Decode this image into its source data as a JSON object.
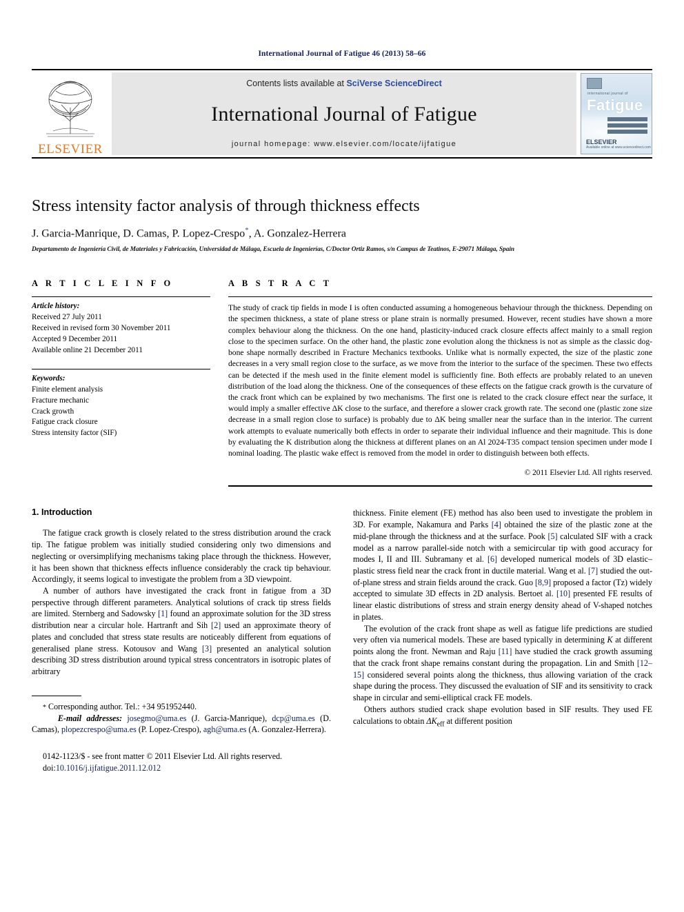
{
  "running_head": "International Journal of Fatigue 46 (2013) 58–66",
  "masthead": {
    "publisher_name": "ELSEVIER",
    "contents_prefix": "Contents lists available at ",
    "contents_link": "SciVerse ScienceDirect",
    "journal_title": "International Journal of Fatigue",
    "homepage": "journal homepage: www.elsevier.com/locate/ijfatigue",
    "cover": {
      "small_title": "international journal of",
      "big_title": "Fatigue",
      "foot_brand": "ELSEVIER",
      "foot_tagline": "Available online at www.sciencedirect.com"
    }
  },
  "article": {
    "title": "Stress intensity factor analysis of through thickness effects",
    "authors": "J. Garcia-Manrique, D. Camas, P. Lopez-Crespo",
    "authors_corresponding_mark": "*",
    "authors_tail": ", A. Gonzalez-Herrera",
    "affiliation": "Departamento de Ingeniería Civil, de Materiales y Fabricación, Universidad de Málaga, Escuela de Ingenierías, C/Doctor Ortiz Ramos, s/n Campus de Teatinos, E-29071 Málaga, Spain"
  },
  "article_info": {
    "heading": "A R T I C L E   I N F O",
    "history_label": "Article history:",
    "history": [
      "Received 27 July 2011",
      "Received in revised form 30 November 2011",
      "Accepted 9 December 2011",
      "Available online 21 December 2011"
    ],
    "keywords_label": "Keywords:",
    "keywords": [
      "Finite element analysis",
      "Fracture mechanic",
      "Crack growth",
      "Fatigue crack closure",
      "Stress intensity factor (SIF)"
    ]
  },
  "abstract": {
    "heading": "A B S T R A C T",
    "text": "The study of crack tip fields in mode I is often conducted assuming a homogeneous behaviour through the thickness. Depending on the specimen thickness, a state of plane stress or plane strain is normally presumed. However, recent studies have shown a more complex behaviour along the thickness. On the one hand, plasticity-induced crack closure effects affect mainly to a small region close to the specimen surface. On the other hand, the plastic zone evolution along the thickness is not as simple as the classic dog-bone shape normally described in Fracture Mechanics textbooks. Unlike what is normally expected, the size of the plastic zone decreases in a very small region close to the surface, as we move from the interior to the surface of the specimen. These two effects can be detected if the mesh used in the finite element model is sufficiently fine. Both effects are probably related to an uneven distribution of the load along the thickness. One of the consequences of these effects on the fatigue crack growth is the curvature of the crack front which can be explained by two mechanisms. The first one is related to the crack closure effect near the surface, it would imply a smaller effective ΔK close to the surface, and therefore a slower crack growth rate. The second one (plastic zone size decrease in a small region close to surface) is probably due to ΔK being smaller near the surface than in the interior. The current work attempts to evaluate numerically both effects in order to separate their individual influence and their magnitude. This is done by evaluating the K distribution along the thickness at different planes on an Al 2024-T35 compact tension specimen under mode I nominal loading. The plastic wake effect is removed from the model in order to distinguish between both effects.",
    "copyright": "© 2011 Elsevier Ltd. All rights reserved."
  },
  "introduction": {
    "heading": "1. Introduction",
    "left_paragraphs": [
      "The fatigue crack growth is closely related to the stress distribution around the crack tip. The fatigue problem was initially studied considering only two dimensions and neglecting or oversimplifying mechanisms taking place through the thickness. However, it has been shown that thickness effects influence considerably the crack tip behaviour. Accordingly, it seems logical to investigate the problem from a 3D viewpoint."
    ],
    "left_para2_parts": {
      "a": "A number of authors have investigated the crack front in fatigue from a 3D perspective through different parameters. Analytical solutions of crack tip stress fields are limited. Sternberg and Sadowsky ",
      "r1": "[1]",
      "b": " found an approximate solution for the 3D stress distribution near a circular hole. Hartranft and Sih ",
      "r2": "[2]",
      "c": " used an approximate theory of plates and concluded that stress state results are noticeably different from equations of generalised plane stress. Kotousov and Wang ",
      "r3": "[3]",
      "d": " presented an analytical solution describing 3D stress distribution around typical stress concentrators in isotropic plates of arbitrary"
    },
    "right_para1_parts": {
      "a": "thickness. Finite element (FE) method has also been used to investigate the problem in 3D. For example, Nakamura and Parks ",
      "r4": "[4]",
      "b": " obtained the size of the plastic zone at the mid-plane through the thickness and at the surface. Pook ",
      "r5": "[5]",
      "c": " calculated SIF with a crack model as a narrow parallel-side notch with a semicircular tip with good accuracy for modes I, II and III. Subramany et al. ",
      "r6": "[6]",
      "d": " developed numerical models of 3D elastic–plastic stress field near the crack front in ductile material. Wang et al. ",
      "r7": "[7]",
      "e": " studied the out-of-plane stress and strain fields around the crack. Guo ",
      "r8": "[8,9]",
      "f": " proposed a factor (Tz) widely accepted to simulate 3D effects in 2D analysis. Bertoet al. ",
      "r10": "[10]",
      "g": " presented FE results of linear elastic distributions of stress and strain energy density ahead of V-shaped notches in plates."
    },
    "right_para2_parts": {
      "a": "The evolution of the crack front shape as well as fatigue life predictions are studied very often via numerical models. These are based typically in determining ",
      "k": "K",
      "b": " at different points along the front. Newman and Raju ",
      "r11": "[11]",
      "c": " have studied the crack growth assuming that the crack front shape remains constant during the propagation. Lin and Smith ",
      "r12": "[12–15]",
      "d": " considered several points along the thickness, thus allowing variation of the crack shape during the process. They discussed the evaluation of SIF and its sensitivity to crack shape in circular and semi-elliptical crack FE models."
    },
    "right_para3_parts": {
      "a": "Others authors studied crack shape evolution based in SIF results. They used FE calculations to obtain ",
      "dk": "ΔK",
      "sub": "eff",
      "b": " at different position"
    }
  },
  "footnote": {
    "star": "*",
    "corresponding": " Corresponding author. Tel.: +34 951952440.",
    "email_label": "E-mail addresses:",
    "emails": [
      {
        "addr": "josegmo@uma.es",
        "owner": " (J. Garcia-Manrique), "
      },
      {
        "addr": "dcp@uma.es",
        "owner": " (D. Camas), "
      },
      {
        "addr": "plopezcrespo@uma.es",
        "owner": " (P. Lopez-Crespo), "
      },
      {
        "addr": "agh@uma.es",
        "owner": " (A. Gonzalez-Herrera)."
      }
    ]
  },
  "issn_line": "0142-1123/$ - see front matter © 2011 Elsevier Ltd. All rights reserved.",
  "doi_label": "doi:",
  "doi_value": "10.1016/j.ijfatigue.2011.12.012",
  "colors": {
    "link_blue": "#12215c",
    "sciverse_blue": "#2b4aa0",
    "elsevier_orange": "#E87722"
  }
}
